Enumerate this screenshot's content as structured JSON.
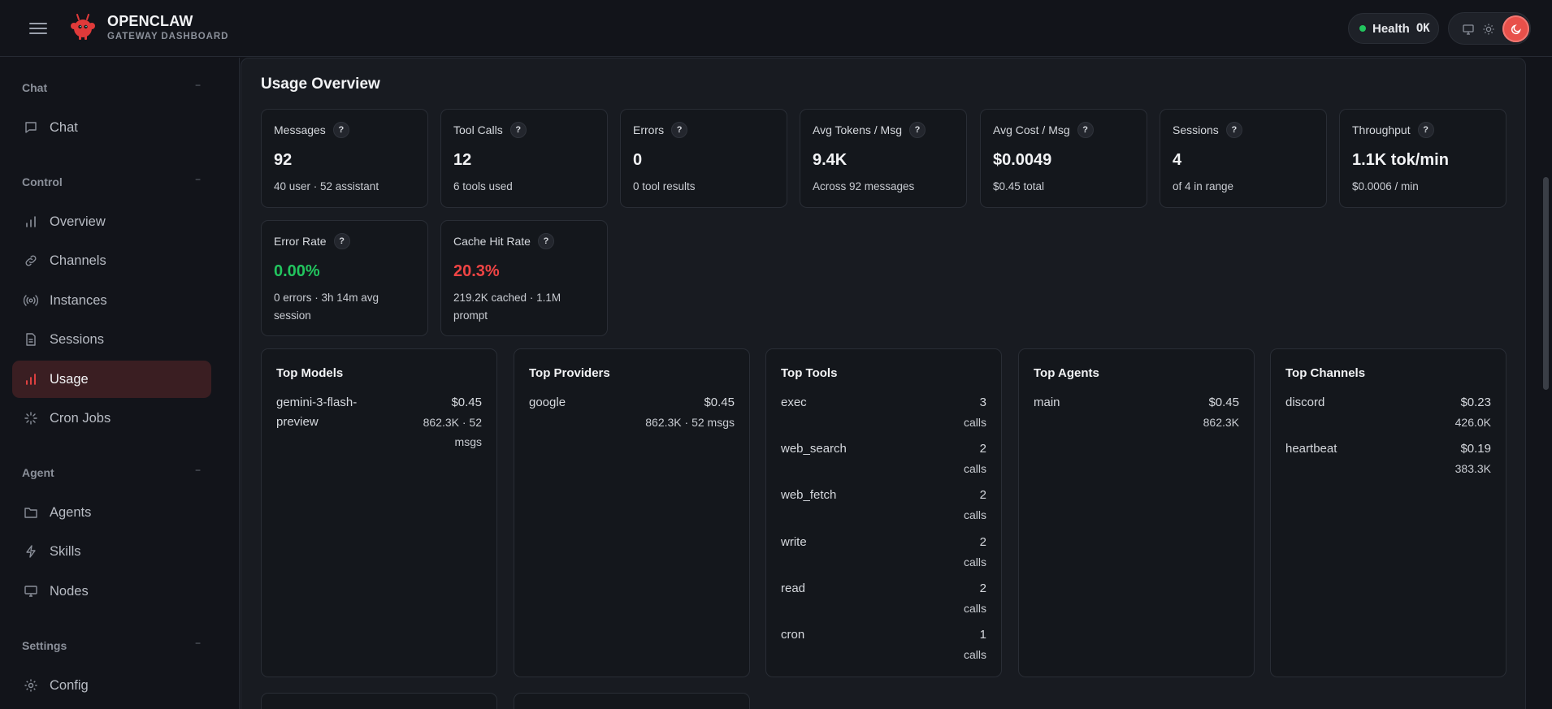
{
  "brand": {
    "name": "OPENCLAW",
    "subtitle": "GATEWAY DASHBOARD"
  },
  "health": {
    "label": "Health",
    "status": "OK",
    "status_color": "#22c55e"
  },
  "sidebar": {
    "sections": [
      {
        "label": "Chat",
        "collapse": "−"
      },
      {
        "label": "Control",
        "collapse": "−"
      },
      {
        "label": "Agent",
        "collapse": "−"
      },
      {
        "label": "Settings",
        "collapse": "−"
      }
    ],
    "items": [
      {
        "label": "Chat",
        "icon": "message-icon"
      },
      {
        "label": "Overview",
        "icon": "bar-chart-icon"
      },
      {
        "label": "Channels",
        "icon": "link-icon"
      },
      {
        "label": "Instances",
        "icon": "radio-icon"
      },
      {
        "label": "Sessions",
        "icon": "document-icon"
      },
      {
        "label": "Usage",
        "icon": "bar-chart-icon",
        "active": true
      },
      {
        "label": "Cron Jobs",
        "icon": "loader-icon"
      },
      {
        "label": "Agents",
        "icon": "folder-icon"
      },
      {
        "label": "Skills",
        "icon": "bolt-icon"
      },
      {
        "label": "Nodes",
        "icon": "monitor-icon"
      },
      {
        "label": "Config",
        "icon": "gear-icon"
      }
    ]
  },
  "main": {
    "title": "Usage Overview",
    "stats": [
      {
        "label": "Messages",
        "value": "92",
        "sub": "40 user · 52 assistant"
      },
      {
        "label": "Tool Calls",
        "value": "12",
        "sub": "6 tools used"
      },
      {
        "label": "Errors",
        "value": "0",
        "sub": "0 tool results"
      },
      {
        "label": "Avg Tokens / Msg",
        "value": "9.4K",
        "sub": "Across 92 messages"
      },
      {
        "label": "Avg Cost / Msg",
        "value": "$0.0049",
        "sub": "$0.45 total"
      },
      {
        "label": "Sessions",
        "value": "4",
        "sub": "of 4 in range"
      },
      {
        "label": "Throughput",
        "value": "1.1K tok/min",
        "sub": "$0.0006 / min"
      },
      {
        "label": "Error Rate",
        "value": "0.00%",
        "sub": "0 errors · 3h 14m avg session",
        "value_color": "#22c55e"
      },
      {
        "label": "Cache Hit Rate",
        "value": "20.3%",
        "sub": "219.2K cached · 1.1M prompt",
        "value_color": "#ef4444"
      }
    ],
    "help_glyph": "?",
    "top_models": {
      "title": "Top Models",
      "rows": [
        {
          "name": "gemini-3-flash-preview",
          "name_line1": "gemini-3-flash-",
          "name_line2": "preview",
          "cost": "$0.45",
          "meta1": "862.3K · 52",
          "meta2": "msgs"
        }
      ]
    },
    "top_providers": {
      "title": "Top Providers",
      "rows": [
        {
          "name": "google",
          "cost": "$0.45",
          "meta1": "862.3K · 52 msgs"
        }
      ]
    },
    "top_tools": {
      "title": "Top Tools",
      "unit": "calls",
      "rows": [
        {
          "name": "exec",
          "count": "3"
        },
        {
          "name": "web_search",
          "count": "2"
        },
        {
          "name": "web_fetch",
          "count": "2"
        },
        {
          "name": "write",
          "count": "2"
        },
        {
          "name": "read",
          "count": "2"
        },
        {
          "name": "cron",
          "count": "1"
        }
      ]
    },
    "top_agents": {
      "title": "Top Agents",
      "rows": [
        {
          "name": "main",
          "cost": "$0.45",
          "meta1": "862.3K"
        }
      ]
    },
    "top_channels": {
      "title": "Top Channels",
      "rows": [
        {
          "name": "discord",
          "cost": "$0.23",
          "meta1": "426.0K"
        },
        {
          "name": "heartbeat",
          "cost": "$0.19",
          "meta1": "383.3K"
        }
      ]
    }
  }
}
